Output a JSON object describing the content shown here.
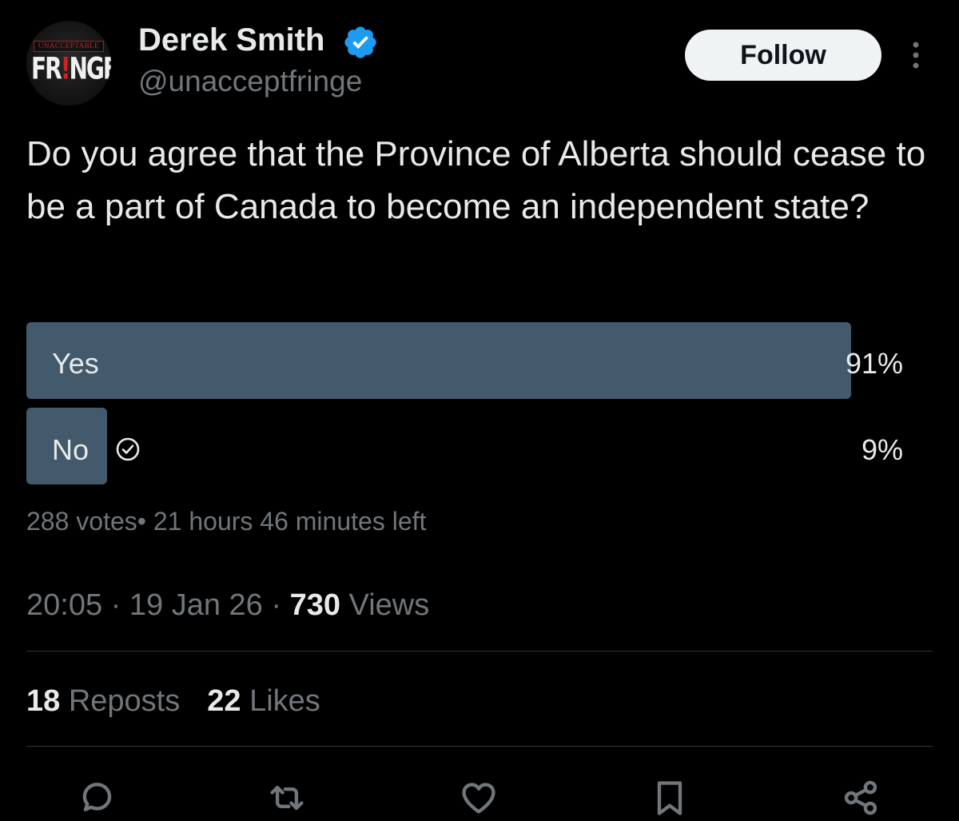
{
  "author": {
    "avatar_top_text": "UNACCEPTABLE",
    "avatar_main_pre": "FR",
    "avatar_main_bang": "!",
    "avatar_main_post": "NGE",
    "display_name": "Derek Smith",
    "handle": "@unacceptfringe",
    "verified_icon": "verified-badge-icon"
  },
  "header": {
    "follow_label": "Follow",
    "more_icon": "more-vertical-icon"
  },
  "tweet": {
    "question": "Do you agree that the Province of Alberta should cease to be a part of Canada to become an independent state?"
  },
  "poll": {
    "options": [
      {
        "label": "Yes",
        "percent_text": "91%",
        "percent": 91,
        "selected": false
      },
      {
        "label": "No",
        "percent_text": "9%",
        "percent": 9,
        "selected": true
      }
    ],
    "votes_text": "288 votes",
    "separator": "•",
    "time_left_text": " 21 hours 46 minutes left",
    "bar_color": "#425a6b"
  },
  "meta": {
    "time": "20:05",
    "date": "19 Jan 26",
    "sep": " · ",
    "views_count": "730",
    "views_label": " Views"
  },
  "stats": {
    "reposts_count": "18",
    "reposts_label": " Reposts",
    "likes_count": "22",
    "likes_label": " Likes"
  },
  "actions": [
    {
      "name": "reply",
      "icon": "reply-icon"
    },
    {
      "name": "repost",
      "icon": "repost-icon"
    },
    {
      "name": "like",
      "icon": "heart-icon"
    },
    {
      "name": "bookmark",
      "icon": "bookmark-icon"
    },
    {
      "name": "share",
      "icon": "share-icon"
    }
  ],
  "colors": {
    "background": "#000000",
    "text_primary": "#e7e9ea",
    "text_secondary": "#71767b",
    "verified_blue": "#1d9bf0",
    "divider": "#2f3336",
    "follow_bg": "#eff3f4"
  }
}
